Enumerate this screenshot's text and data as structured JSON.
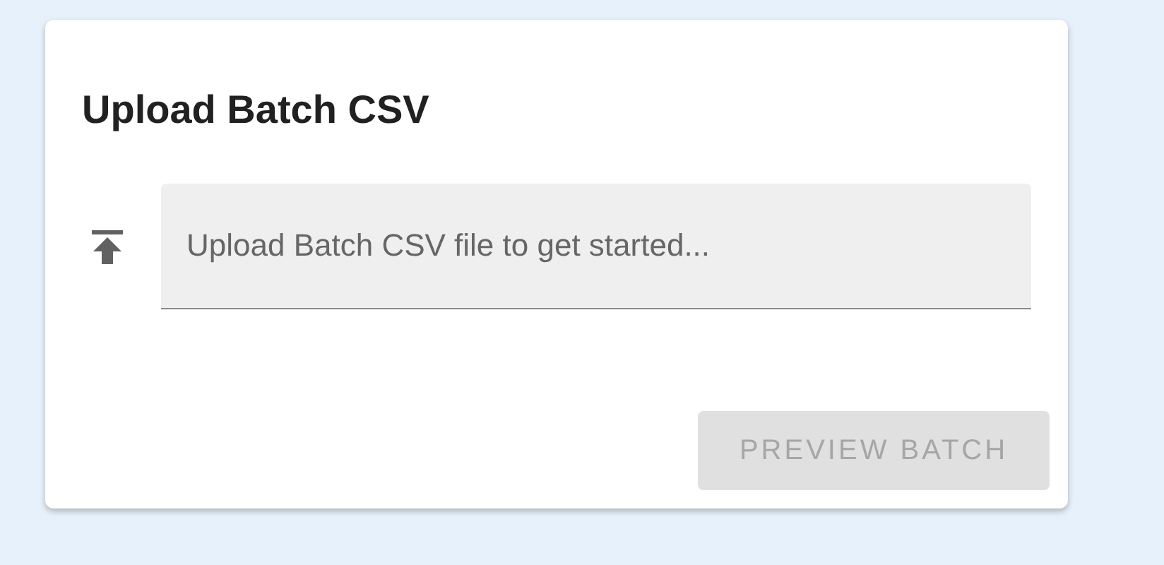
{
  "card": {
    "title": "Upload Batch CSV",
    "upload_field": {
      "placeholder": "Upload Batch CSV file to get started..."
    },
    "preview_button": {
      "label": "PREVIEW BATCH",
      "disabled": true
    }
  }
}
